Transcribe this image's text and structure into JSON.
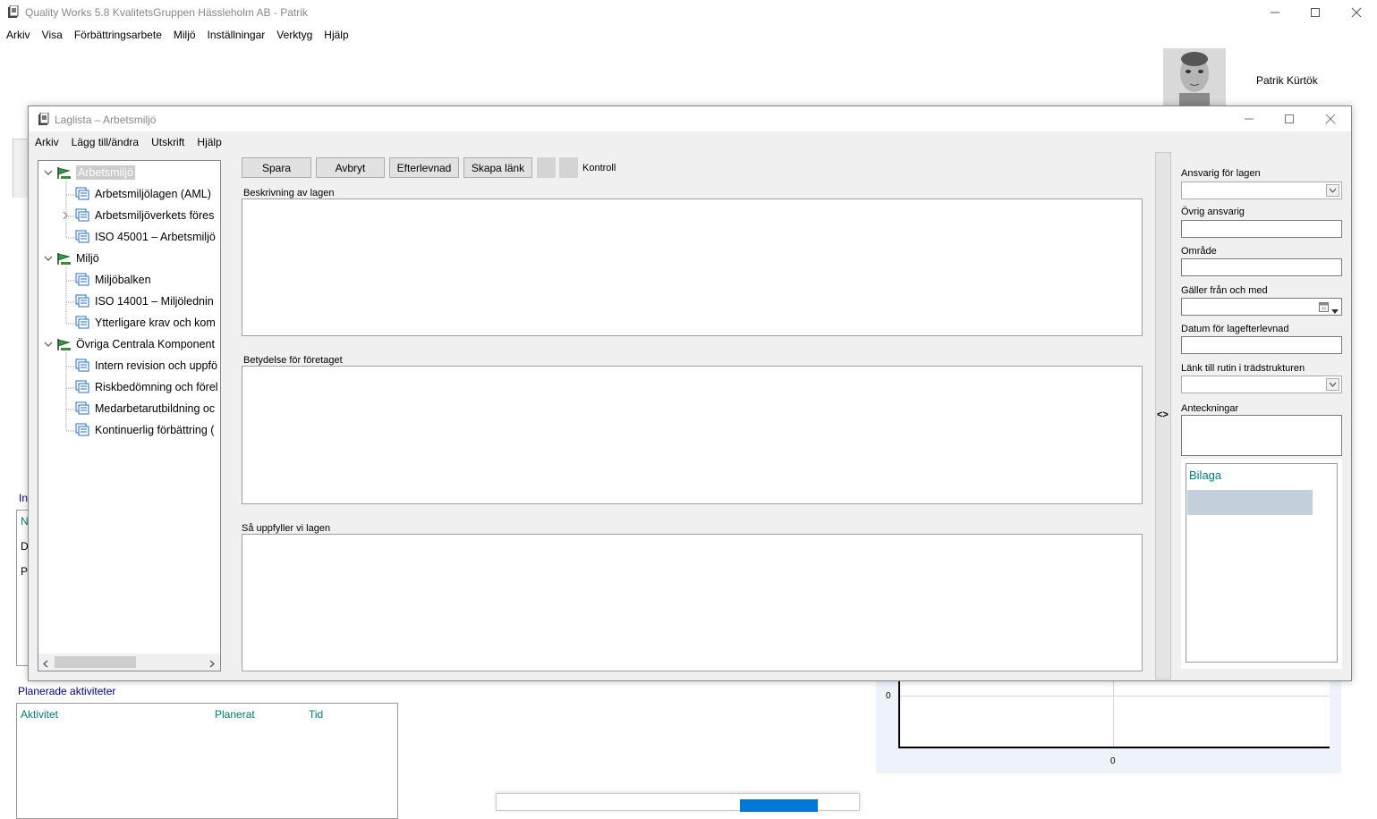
{
  "main_window": {
    "title": "Quality Works 5.8 KvalitetsGruppen Hässleholm AB - Patrik",
    "menu": [
      "Arkiv",
      "Visa",
      "Förbättringsarbete",
      "Miljö",
      "Inställningar",
      "Verktyg",
      "Hjälp"
    ],
    "user_name": "Patrik Kürtök"
  },
  "background": {
    "partial_labels": [
      "In",
      "N",
      "D",
      "P"
    ],
    "planned": {
      "title": "Planerade aktiviteter",
      "columns": [
        "Aktivitet",
        "Planerat",
        "Tid"
      ]
    },
    "chart_axis_y": "0",
    "chart_axis_x": "0"
  },
  "dialog": {
    "title": "Laglista – Arbetsmiljö",
    "menu": [
      "Arkiv",
      "Lägg till/ändra",
      "Utskrift",
      "Hjälp"
    ],
    "tree": [
      {
        "label": "Arbetsmiljö",
        "level": 0,
        "type": "folder",
        "expanded": true,
        "selected": true
      },
      {
        "label": "Arbetsmiljölagen (AML)",
        "level": 1,
        "type": "doc"
      },
      {
        "label": "Arbetsmiljöverkets föres",
        "level": 1,
        "type": "doc",
        "expandable": true
      },
      {
        "label": "ISO 45001 – Arbetsmiljö",
        "level": 1,
        "type": "doc"
      },
      {
        "label": "Miljö",
        "level": 0,
        "type": "folder",
        "expanded": true
      },
      {
        "label": "Miljöbalken",
        "level": 1,
        "type": "doc"
      },
      {
        "label": "ISO 14001 – Miljölednin",
        "level": 1,
        "type": "doc"
      },
      {
        "label": "Ytterligare krav och kom",
        "level": 1,
        "type": "doc"
      },
      {
        "label": "Övriga Centrala Komponent",
        "level": 0,
        "type": "folder",
        "expanded": true
      },
      {
        "label": "Intern revision och uppfö",
        "level": 1,
        "type": "doc"
      },
      {
        "label": "Riskbedömning och förel",
        "level": 1,
        "type": "doc"
      },
      {
        "label": "Medarbetarutbildning oc",
        "level": 1,
        "type": "doc"
      },
      {
        "label": "Kontinuerlig förbättring (",
        "level": 1,
        "type": "doc"
      }
    ],
    "toolbar": {
      "save": "Spara",
      "cancel": "Avbryt",
      "compliance": "Efterlevnad",
      "create_link": "Skapa länk",
      "control": "Kontroll"
    },
    "sections": {
      "description": "Beskrivning av lagen",
      "significance": "Betydelse för företaget",
      "fulfillment": "Så uppfyller vi lagen"
    },
    "splitter": "<>",
    "right_panel": {
      "responsible": "Ansvarig för lagen",
      "other_responsible": "Övrig ansvarig",
      "area": "Område",
      "valid_from": "Gäller från och med",
      "compliance_date": "Datum för lagefterlevnad",
      "link_routine": "Länk till rutin i trädstrukturen",
      "notes": "Anteckningar",
      "attachment": "Bilaga"
    }
  },
  "colors": {
    "teal_text": "#007b7b",
    "navy_text": "#000080",
    "dialog_bg": "#f0f0f0",
    "selected_node_bg": "#cccccc",
    "attachment_highlight": "#c3cfdb"
  }
}
